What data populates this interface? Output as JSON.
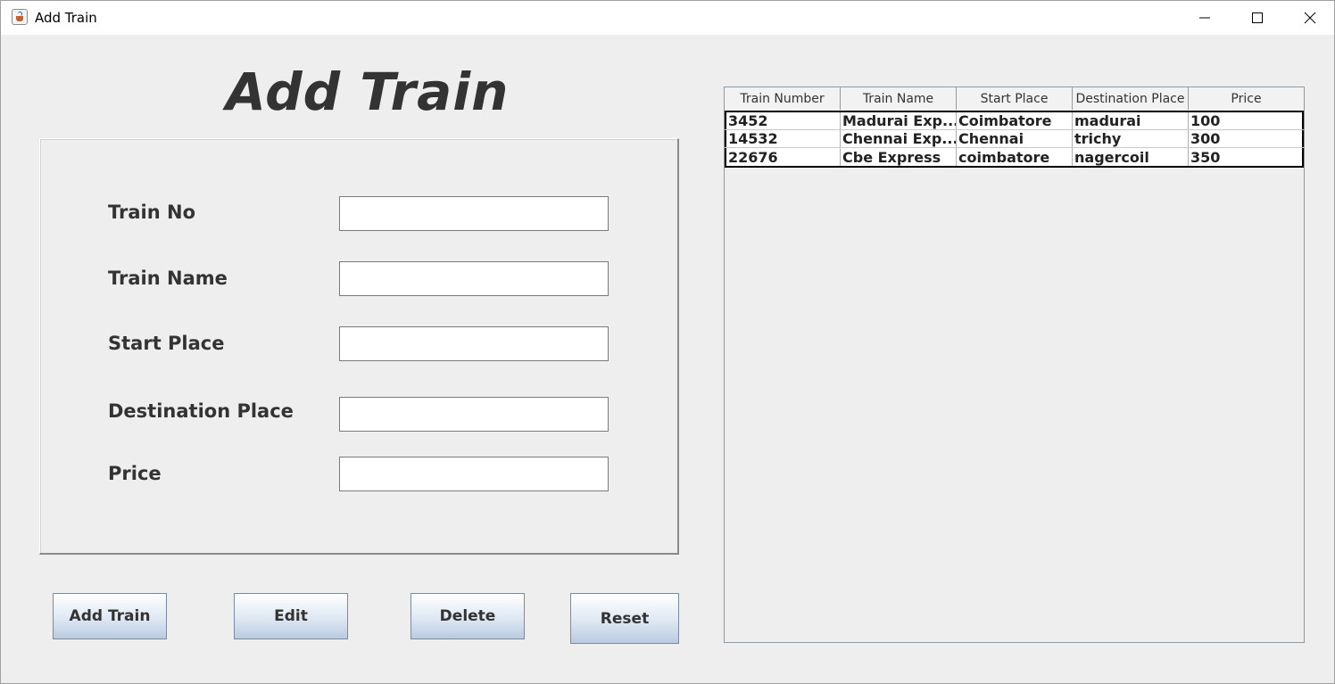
{
  "window": {
    "title": "Add Train"
  },
  "heading": "Add Train",
  "form": {
    "fields": [
      {
        "label": "Train No",
        "value": ""
      },
      {
        "label": "Train Name",
        "value": ""
      },
      {
        "label": "Start Place",
        "value": ""
      },
      {
        "label": "Destination Place",
        "value": ""
      },
      {
        "label": "Price",
        "value": ""
      }
    ]
  },
  "buttons": {
    "add": "Add Train",
    "edit": "Edit",
    "delete": "Delete",
    "reset": "Reset"
  },
  "table": {
    "columns": [
      "Train Number",
      "Train Name",
      "Start Place",
      "Destination Place",
      "Price"
    ],
    "rows": [
      [
        "3452",
        "Madurai Exp...",
        "Coimbatore",
        "madurai",
        "100"
      ],
      [
        "14532",
        "Chennai Exp...",
        "Chennai",
        "trichy",
        "300"
      ],
      [
        "22676",
        "Cbe Express",
        "coimbatore",
        "nagercoil",
        "350"
      ]
    ]
  },
  "icons": {
    "app": "java-cup-icon",
    "minimize": "minimize-icon",
    "maximize": "maximize-icon",
    "close": "close-icon"
  }
}
